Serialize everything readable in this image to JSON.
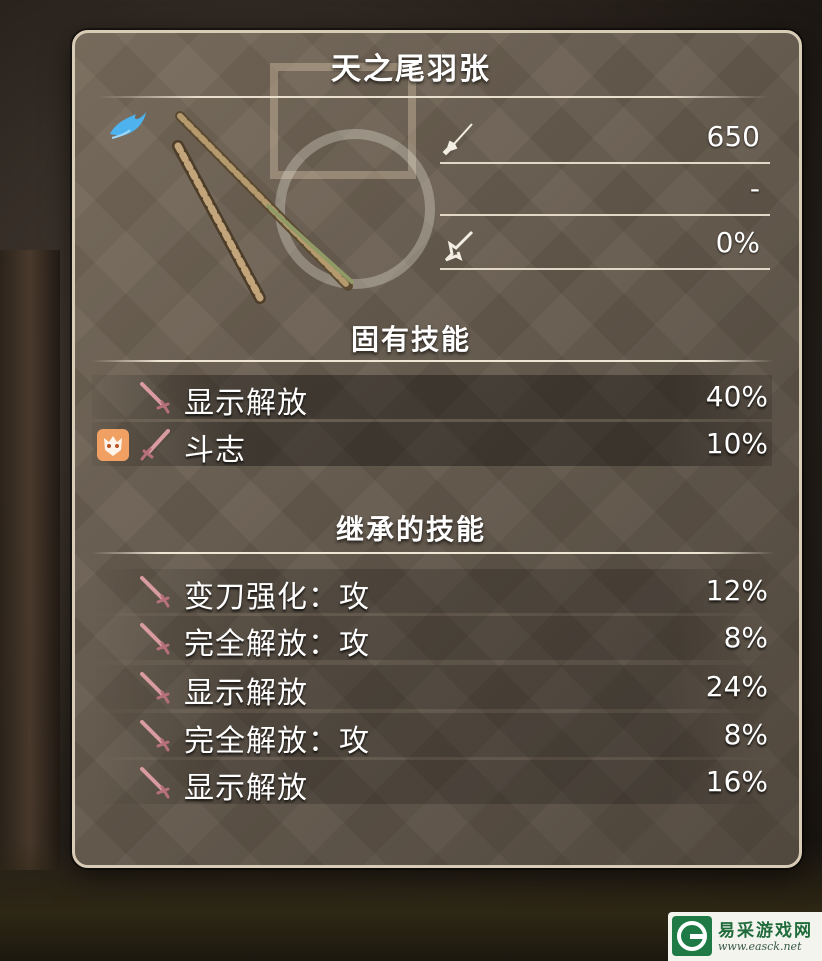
{
  "weapon": {
    "name": "天之尾羽张",
    "stats": [
      {
        "icon": "sword-attack-icon",
        "value": "650"
      },
      {
        "icon": "element-icon",
        "value": "-"
      },
      {
        "icon": "affinity-icon",
        "value": "0%"
      }
    ]
  },
  "innate_skills": {
    "title": "固有技能",
    "items": [
      {
        "name": "显示解放",
        "value": "40%",
        "extra_icon": ""
      },
      {
        "name": "斗志",
        "value": "10%",
        "extra_icon": "demon-mask-icon"
      }
    ]
  },
  "inherited_skills": {
    "title": "继承的技能",
    "items": [
      {
        "name": "变刀强化：攻",
        "value": "12%"
      },
      {
        "name": "完全解放：攻",
        "value": "8%"
      },
      {
        "name": "显示解放",
        "value": "24%"
      },
      {
        "name": "完全解放：攻",
        "value": "8%"
      },
      {
        "name": "显示解放",
        "value": "16%"
      }
    ]
  },
  "watermark": {
    "text": "易采游戏网",
    "url": "www.easck.net"
  },
  "colors": {
    "panel_border": "#d9ccb6",
    "rarity_blue": "#4db2ee",
    "mask_orange": "#f0a063",
    "blade_pink": "#d99ba0"
  }
}
